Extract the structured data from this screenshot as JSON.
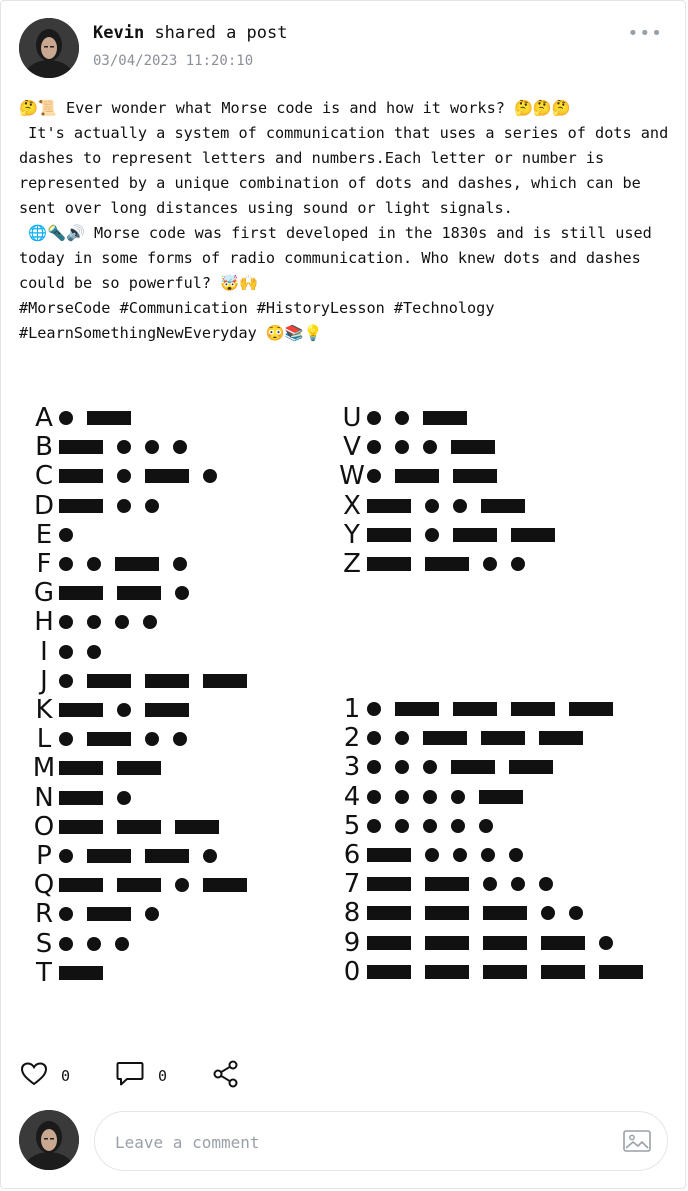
{
  "post": {
    "author": "Kevin",
    "action": "shared a post",
    "timestamp": "03/04/2023 11:20:10",
    "more_label": "•••",
    "text": "🤔📜 Ever wonder what Morse code is and how it works? 🤔🤔🤔\n It's actually a system of communication that uses a series of dots and dashes to represent letters and numbers.Each letter or number is represented by a unique combination of dots and dashes, which can be sent over long distances using sound or light signals.\n 🌐🔦🔊 Morse code was first developed in the 1830s and is still used today in some forms of radio communication. Who knew dots and dashes could be so powerful? 🤯🙌\n#MorseCode #Communication #HistoryLesson #Technology #LearnSomethingNewEveryday 😳📚💡"
  },
  "morse_chart": {
    "left": [
      {
        "ch": "A",
        "code": ".-"
      },
      {
        "ch": "B",
        "code": "-..."
      },
      {
        "ch": "C",
        "code": "-.-."
      },
      {
        "ch": "D",
        "code": "-.."
      },
      {
        "ch": "E",
        "code": "."
      },
      {
        "ch": "F",
        "code": "..-."
      },
      {
        "ch": "G",
        "code": "--."
      },
      {
        "ch": "H",
        "code": "...."
      },
      {
        "ch": "I",
        "code": ".."
      },
      {
        "ch": "J",
        "code": ".---"
      },
      {
        "ch": "K",
        "code": "-.-"
      },
      {
        "ch": "L",
        "code": ".-.."
      },
      {
        "ch": "M",
        "code": "--"
      },
      {
        "ch": "N",
        "code": "-."
      },
      {
        "ch": "O",
        "code": "---"
      },
      {
        "ch": "P",
        "code": ".--."
      },
      {
        "ch": "Q",
        "code": "--.-"
      },
      {
        "ch": "R",
        "code": ".-."
      },
      {
        "ch": "S",
        "code": "..."
      },
      {
        "ch": "T",
        "code": "-"
      }
    ],
    "right_letters": [
      {
        "ch": "U",
        "code": "..-"
      },
      {
        "ch": "V",
        "code": "...-"
      },
      {
        "ch": "W",
        "code": ".--"
      },
      {
        "ch": "X",
        "code": "-..-"
      },
      {
        "ch": "Y",
        "code": "-.--"
      },
      {
        "ch": "Z",
        "code": "--.."
      }
    ],
    "right_digits": [
      {
        "ch": "1",
        "code": ".----"
      },
      {
        "ch": "2",
        "code": "..---"
      },
      {
        "ch": "3",
        "code": "...--"
      },
      {
        "ch": "4",
        "code": "....-"
      },
      {
        "ch": "5",
        "code": "....."
      },
      {
        "ch": "6",
        "code": "-...."
      },
      {
        "ch": "7",
        "code": "--..."
      },
      {
        "ch": "8",
        "code": "---.."
      },
      {
        "ch": "9",
        "code": "----."
      },
      {
        "ch": "0",
        "code": "-----"
      }
    ]
  },
  "actions": {
    "likes": "0",
    "comments": "0"
  },
  "comment": {
    "placeholder": "Leave a comment",
    "value": ""
  },
  "icons": {
    "like": "heart-icon",
    "comment": "comment-bubble-icon",
    "share": "share-icon",
    "image": "image-icon"
  }
}
